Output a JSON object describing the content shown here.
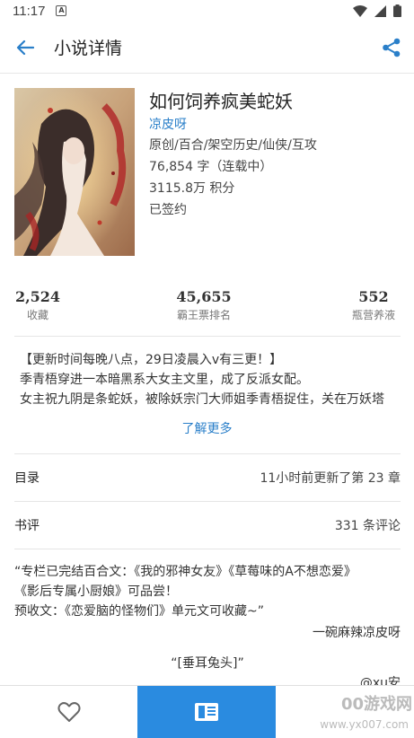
{
  "status_bar": {
    "time": "11:17",
    "notification_icon": "A"
  },
  "app_bar": {
    "title": "小说详情"
  },
  "book": {
    "title": "如何饲养疯美蛇妖",
    "author": "凉皮呀",
    "tags": "原创/百合/架空历史/仙侠/互攻",
    "word_count": "76,854 字（连载中）",
    "points": "3115.8万 积分",
    "contract": "已签约"
  },
  "stats": [
    {
      "value": "2,524",
      "label": "收藏"
    },
    {
      "value": "45,655",
      "label": "霸王票排名"
    },
    {
      "value": "552",
      "label": "瓶营养液"
    }
  ],
  "description": {
    "lines": [
      "【更新时间每晚八点，29日凌晨入v有三更！】",
      "季青梧穿进一本暗黑系大女主文里，成了反派女配。",
      "女主祝九阴是条蛇妖，被除妖宗门大师姐季青梧捉住，关在万妖塔"
    ],
    "more_label": "了解更多"
  },
  "catalog": {
    "label": "目录",
    "value": "11小时前更新了第 23 章"
  },
  "reviews": {
    "label": "书评",
    "value": "331 条评论"
  },
  "review_item": {
    "lines": [
      "“专栏已完结百合文：《我的邪神女友》《草莓味的A不想恋爱》",
      "《影后专属小厨娘》可品尝！",
      "预收文：《恋爱脑的怪物们》单元文可收藏~”"
    ],
    "signature": "一碗麻辣凉皮呀",
    "subtitle": "“[垂耳兔头]”",
    "user": "@xu安"
  },
  "watermark": {
    "text": "00游戏网",
    "url": "www.yx007.com"
  },
  "colors": {
    "accent": "#2a7fc9",
    "read_button": "#2a8be0"
  }
}
